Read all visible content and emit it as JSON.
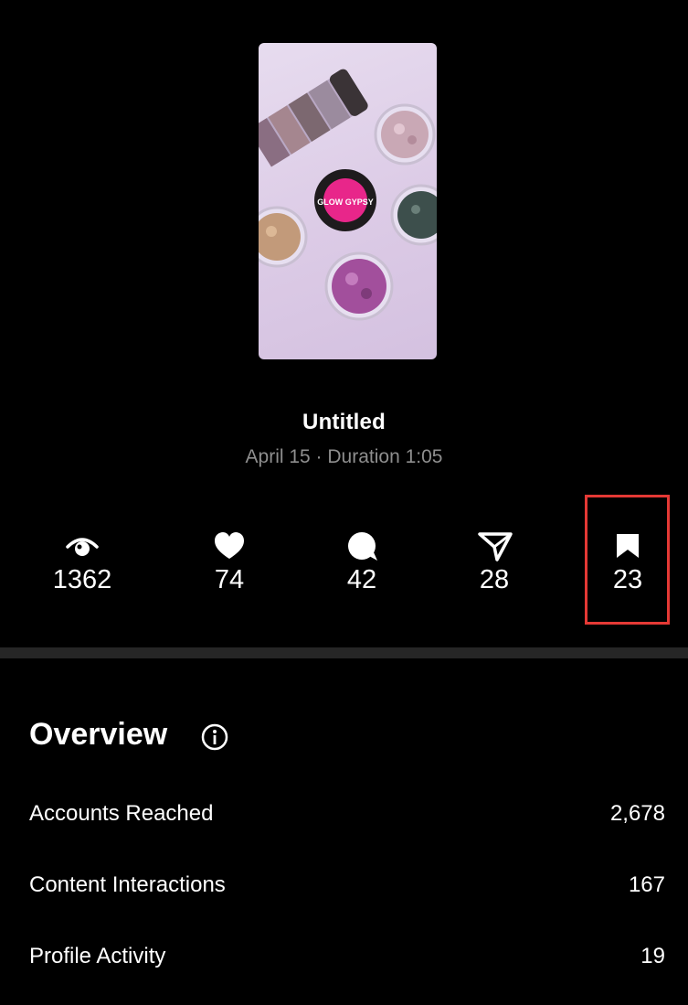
{
  "media": {
    "thumbnail_alt": "Glitter pots product photo",
    "thumbnail_logo_text": "GLOW GYPSY",
    "title": "Untitled",
    "meta": "April 15 · Duration 1:05"
  },
  "stats": [
    {
      "icon": "eye-icon",
      "value": "1362"
    },
    {
      "icon": "heart-icon",
      "value": "74"
    },
    {
      "icon": "comment-icon",
      "value": "42"
    },
    {
      "icon": "share-icon",
      "value": "28"
    },
    {
      "icon": "bookmark-icon",
      "value": "23"
    }
  ],
  "overview": {
    "title": "Overview",
    "rows": [
      {
        "label": "Accounts Reached",
        "value": "2,678"
      },
      {
        "label": "Content Interactions",
        "value": "167"
      },
      {
        "label": "Profile Activity",
        "value": "19"
      }
    ]
  },
  "colors": {
    "background": "#000000",
    "text": "#ffffff",
    "muted": "#8e8e8e",
    "highlight": "#e53935"
  }
}
